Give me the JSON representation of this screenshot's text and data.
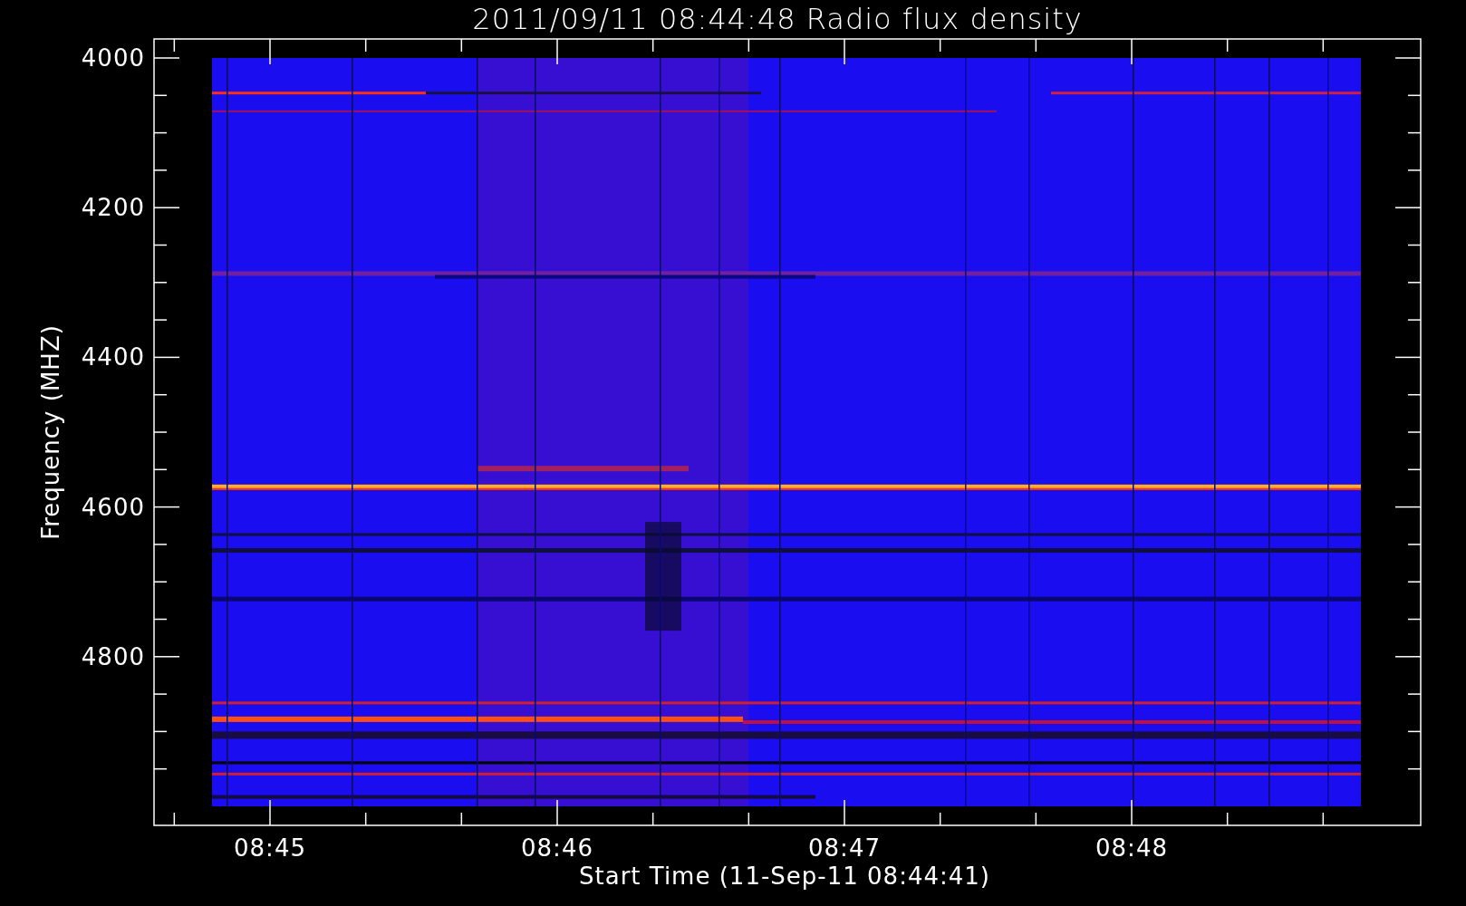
{
  "title": "2011/09/11 08:44:48 Radio flux density",
  "y_axis": {
    "label": "Frequency (MHZ)",
    "ticks": [
      "4000",
      "4200",
      "4400",
      "4600",
      "4800"
    ]
  },
  "x_axis": {
    "label": "Start Time (11-Sep-11 08:44:41)",
    "ticks": [
      "08:45",
      "08:46",
      "08:47",
      "08:48"
    ]
  }
}
